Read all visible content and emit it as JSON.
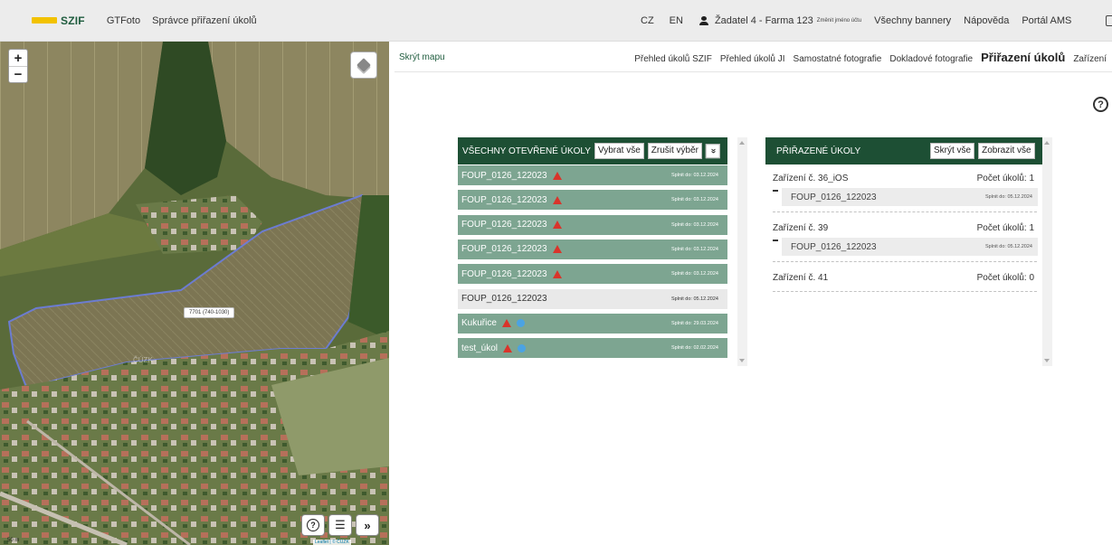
{
  "topbar": {
    "logo": "SZIF",
    "nav": [
      "GTFoto",
      "Správce přiřazení úkolů"
    ],
    "lang_cz": "CZ",
    "lang_en": "EN",
    "user": "Žadatel 4 - Farma 123",
    "change_user": "Změnit jméno účtu",
    "links": [
      "Všechny bannery",
      "Nápověda",
      "Portál AMS"
    ]
  },
  "map": {
    "zoom_in": "+",
    "zoom_out": "−",
    "parcel_label": "7701 (740-1030)",
    "watermark": "ČÚZK",
    "scale": "50 m",
    "attribution": "Leaflet | © ČÚZK",
    "help_btn": "?",
    "list_btn": "☰",
    "expand_btn": "»",
    "colors": {
      "parcel_outline": "#5a6fd6"
    }
  },
  "hide_map": "Skrýt mapu",
  "subnav": [
    "Přehled úkolů SZIF",
    "Přehled úkolů JI",
    "Samostatné fotografie",
    "Dokladové fotografie",
    "Přiřazení úkolů",
    "Zařízení"
  ],
  "subnav_active": "Přiřazení úkolů",
  "help": "?",
  "open_tasks": {
    "title": "VŠECHNY OTEVŘENÉ ÚKOLY",
    "select_all": "Vybrat vše",
    "deselect": "Zrušit výběr",
    "chevron": "»",
    "rows": [
      {
        "name": "FOUP_0126_122023",
        "due": "Splnit do: 03.12.2024",
        "warn": true,
        "info": false
      },
      {
        "name": "FOUP_0126_122023",
        "due": "Splnit do: 03.12.2024",
        "warn": true,
        "info": false
      },
      {
        "name": "FOUP_0126_122023",
        "due": "Splnit do: 03.12.2024",
        "warn": true,
        "info": false
      },
      {
        "name": "FOUP_0126_122023",
        "due": "Splnit do: 03.12.2024",
        "warn": true,
        "info": false
      },
      {
        "name": "FOUP_0126_122023",
        "due": "Splnit do: 03.12.2024",
        "warn": true,
        "info": false
      },
      {
        "name": "FOUP_0126_122023",
        "due": "Splnit do: 05.12.2024",
        "warn": false,
        "info": false
      },
      {
        "name": "Kukuřice",
        "due": "Splnit do: 29.03.2024",
        "warn": true,
        "info": true
      },
      {
        "name": "test_úkol",
        "due": "Splnit do: 02.02.2024",
        "warn": true,
        "info": true
      }
    ]
  },
  "assigned": {
    "title": "PŘIŘAZENÉ ÚKOLY",
    "hide_all": "Skrýt vše",
    "show_all": "Zobrazit vše",
    "devices": [
      {
        "name": "Zařízení č. 36_iOS",
        "count": "Počet úkolů: 1",
        "tasks": [
          {
            "name": "FOUP_0126_122023",
            "due": "Splnit do: 05.12.2024"
          }
        ]
      },
      {
        "name": "Zařízení č. 39",
        "count": "Počet úkolů: 1",
        "tasks": [
          {
            "name": "FOUP_0126_122023",
            "due": "Splnit do: 05.12.2024"
          }
        ]
      },
      {
        "name": "Zařízení č. 41",
        "count": "Počet úkolů: 0",
        "tasks": []
      }
    ]
  },
  "colors": {
    "panel_header": "#1d4f34",
    "row_warn": "#7da591",
    "row_normal": "#e9e9e9",
    "warning": "#d9342b",
    "info": "#4ba3e3",
    "logo_accent": "#f2c200"
  }
}
